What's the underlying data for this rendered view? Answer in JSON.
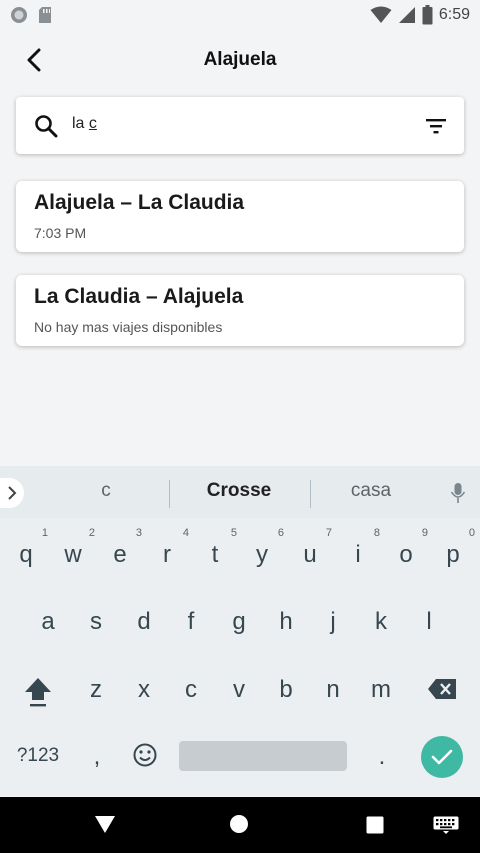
{
  "status_bar": {
    "time": "6:59"
  },
  "header": {
    "title": "Alajuela"
  },
  "search": {
    "value_prefix": "la ",
    "value_underlined": "c",
    "placeholder": ""
  },
  "results": [
    {
      "title": "Alajuela – La Claudia",
      "subtitle": "7:03 PM"
    },
    {
      "title": "La Claudia – Alajuela",
      "subtitle": "No hay mas viajes disponibles"
    }
  ],
  "keyboard": {
    "suggestions": [
      "c",
      "Crosse",
      "casa"
    ],
    "row1": [
      {
        "key": "q",
        "hint": "1"
      },
      {
        "key": "w",
        "hint": "2"
      },
      {
        "key": "e",
        "hint": "3"
      },
      {
        "key": "r",
        "hint": "4"
      },
      {
        "key": "t",
        "hint": "5"
      },
      {
        "key": "y",
        "hint": "6"
      },
      {
        "key": "u",
        "hint": "7"
      },
      {
        "key": "i",
        "hint": "8"
      },
      {
        "key": "o",
        "hint": "9"
      },
      {
        "key": "p",
        "hint": "0"
      }
    ],
    "row2": [
      "a",
      "s",
      "d",
      "f",
      "g",
      "h",
      "j",
      "k",
      "l"
    ],
    "row3": [
      "z",
      "x",
      "c",
      "v",
      "b",
      "n",
      "m"
    ],
    "symbols_label": "?123",
    "comma": ",",
    "period": ".",
    "accent_color": "#3FB8A4"
  }
}
